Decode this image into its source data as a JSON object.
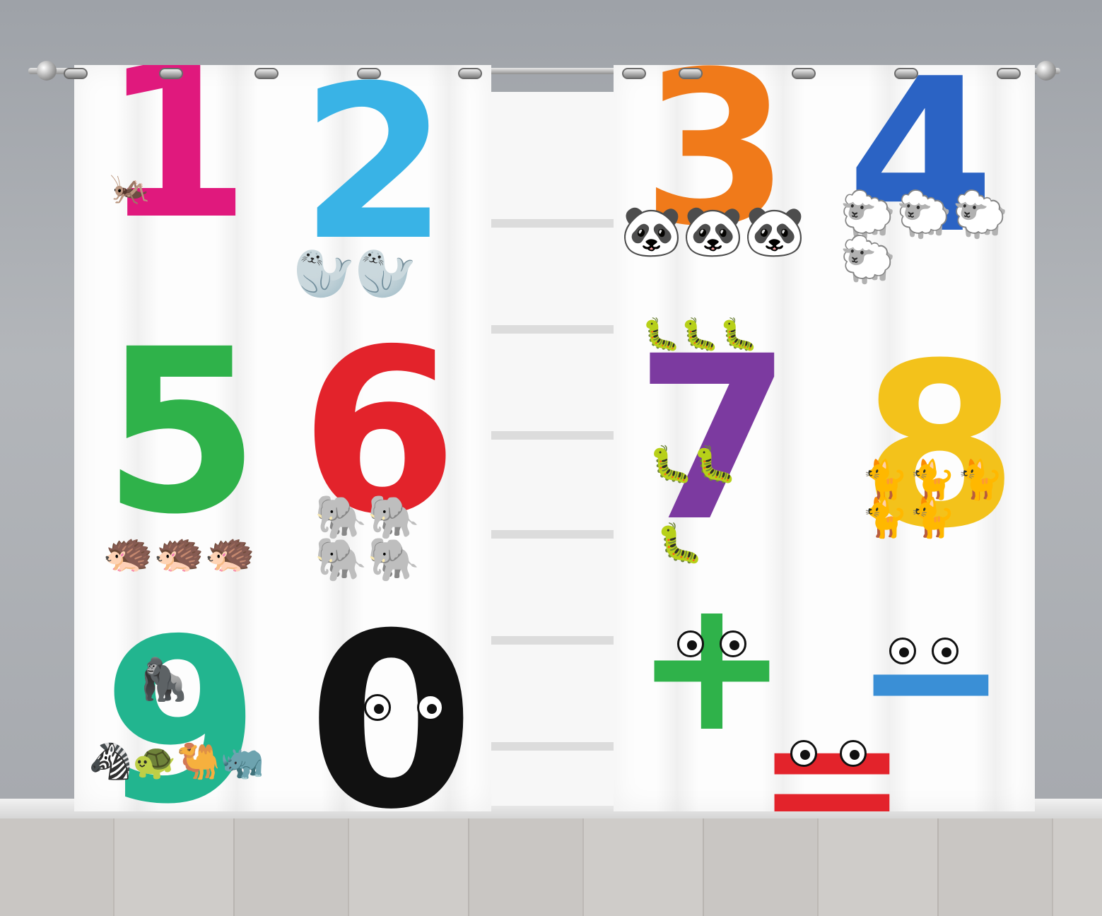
{
  "scene": {
    "wall_color": "#a9acb1",
    "curtain_color": "#fdfdfd"
  },
  "left_panel": {
    "glyphs": [
      {
        "text": "1",
        "color": "#e0197d",
        "icon": "grasshopper-icon"
      },
      {
        "text": "2",
        "color": "#39b3e6",
        "icon": "walrus-icon"
      },
      {
        "text": "5",
        "color": "#2fb24a",
        "icon": "hedgehog-icon"
      },
      {
        "text": "6",
        "color": "#e3232b",
        "icon": "elephant-icon"
      },
      {
        "text": "9",
        "color": "#22b58f",
        "icon": "gorilla-icon"
      },
      {
        "text": "0",
        "color": "#111111",
        "icon": "eyes-icon"
      }
    ]
  },
  "right_panel": {
    "glyphs": [
      {
        "text": "3",
        "color": "#f07a1a",
        "icon": "panda-icon"
      },
      {
        "text": "4",
        "color": "#2b63c4",
        "icon": "sheep-icon"
      },
      {
        "text": "7",
        "color": "#7c3aa0",
        "icon": "caterpillar-icon"
      },
      {
        "text": "8",
        "color": "#f3c21b",
        "icon": "cat-icon"
      },
      {
        "text": "+",
        "color": "#2fb24a",
        "icon": "eyes-icon"
      },
      {
        "text": "−",
        "color": "#3a8fd6",
        "icon": "eyes-icon"
      },
      {
        "text": "=",
        "color": "#e3232b",
        "icon": "eyes-icon"
      }
    ]
  }
}
